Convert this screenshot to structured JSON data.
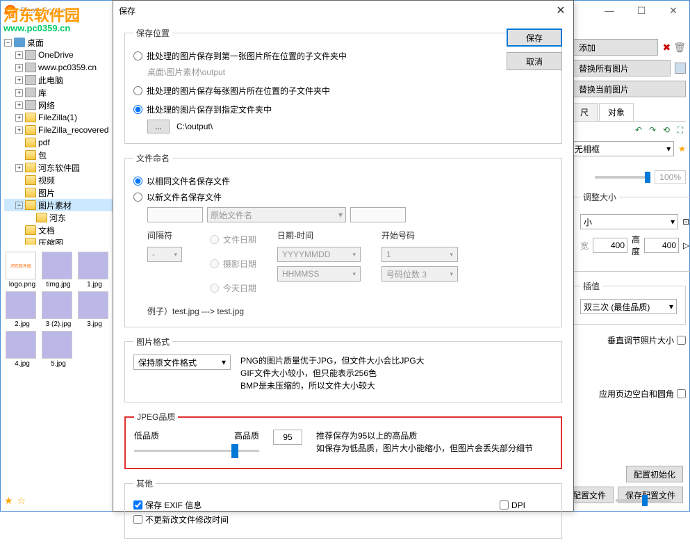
{
  "mainwin": {
    "app_name": "PhotoScape",
    "controls": {
      "min": "—",
      "max": "☐",
      "close": "✕"
    }
  },
  "logo": {
    "line1": "河东软件园",
    "line2": "www.pc0359.cn"
  },
  "tree": {
    "root": "桌面",
    "items": [
      {
        "indent": 0,
        "exp": "⊟",
        "icon": "desktop",
        "label": "桌面"
      },
      {
        "indent": 1,
        "exp": "⊞",
        "icon": "cloud",
        "label": "OneDrive"
      },
      {
        "indent": 1,
        "exp": "⊞",
        "icon": "drive",
        "label": "www.pc0359.cn"
      },
      {
        "indent": 1,
        "exp": "⊞",
        "icon": "drive",
        "label": "此电脑"
      },
      {
        "indent": 1,
        "exp": "⊞",
        "icon": "drive",
        "label": "库"
      },
      {
        "indent": 1,
        "exp": "⊞",
        "icon": "drive",
        "label": "网络"
      },
      {
        "indent": 1,
        "exp": "⊞",
        "icon": "folder",
        "label": "FileZilla(1)"
      },
      {
        "indent": 1,
        "exp": "⊞",
        "icon": "folder",
        "label": "FileZilla_recovered"
      },
      {
        "indent": 1,
        "exp": "",
        "icon": "folder",
        "label": "pdf"
      },
      {
        "indent": 1,
        "exp": "",
        "icon": "folder",
        "label": "包"
      },
      {
        "indent": 1,
        "exp": "⊞",
        "icon": "folder",
        "label": "河东软件园"
      },
      {
        "indent": 1,
        "exp": "",
        "icon": "folder",
        "label": "视频"
      },
      {
        "indent": 1,
        "exp": "",
        "icon": "folder",
        "label": "图片"
      },
      {
        "indent": 1,
        "exp": "⊟",
        "icon": "folder",
        "label": "图片素材",
        "selected": true
      },
      {
        "indent": 2,
        "exp": "",
        "icon": "folder",
        "label": "河东"
      },
      {
        "indent": 1,
        "exp": "",
        "icon": "folder",
        "label": "文档"
      },
      {
        "indent": 1,
        "exp": "",
        "icon": "folder",
        "label": "压缩图"
      }
    ]
  },
  "thumbs": [
    {
      "label": "logo.png",
      "kind": "logo"
    },
    {
      "label": "timg.jpg",
      "kind": "img"
    },
    {
      "label": "1.jpg",
      "kind": "img"
    },
    {
      "label": "2.jpg",
      "kind": "img"
    },
    {
      "label": "3 (2).jpg",
      "kind": "img"
    },
    {
      "label": "3.jpg",
      "kind": "img"
    },
    {
      "label": "4.jpg",
      "kind": "img"
    },
    {
      "label": "5.jpg",
      "kind": "img"
    }
  ],
  "dialog": {
    "title": "保存",
    "close": "✕",
    "btn_save": "保存",
    "btn_cancel": "取消",
    "location": {
      "legend": "保存位置",
      "opt1": "批处理的图片保存到第一张图片所在位置的子文件夹中",
      "opt1_path": "桌面\\图片素材\\output",
      "opt2": "批处理的图片保存每张图片所在位置的子文件夹中",
      "opt3": "批处理的图片保存到指定文件夹中",
      "browse": "...",
      "out_path": "C:\\output\\"
    },
    "naming": {
      "legend": "文件命名",
      "opt1": "以相同文件名保存文件",
      "opt2": "以新文件名保存文件",
      "prefix": "",
      "basename": "原始文件名",
      "suffix": "",
      "sep_label": "间隔符",
      "sep": "-",
      "filedate": "文件日期",
      "shotdate": "摄影日期",
      "today": "今天日期",
      "datetime_label": "日期-时间",
      "date_fmt": "YYYYMMDD",
      "time_fmt": "HHMMSS",
      "startno_label": "开始号码",
      "startno": "1",
      "digits_label": "号码位数 3",
      "example": "例子）test.jpg ---> test.jpg"
    },
    "format": {
      "legend": "图片格式",
      "keep": "保持原文件格式",
      "desc1": "PNG的图片质量优于JPG，但文件大小会比JPG大",
      "desc2": "GIF文件大小较小，但只能表示256色",
      "desc3": "BMP是未压缩的，所以文件大小较大"
    },
    "jpeg": {
      "legend": "JPEG品质",
      "low": "低品质",
      "high": "高品质",
      "value": "95",
      "desc1": "推荐保存为95以上的高品质",
      "desc2": "如保存为低品质，图片大小能缩小，但图片会丢失部分细节"
    },
    "other": {
      "legend": "其他",
      "exif": "保存 EXIF 信息",
      "nomtime": "不更新改文件修改时间",
      "dpi": "DPI"
    }
  },
  "right": {
    "add": "添加",
    "replace_all": "替换所有图片",
    "replace_current": "替换当前图片",
    "tab1": "尺",
    "tab2": "对象",
    "frame_none": "无相框",
    "percent": "100%",
    "resize_legend": "调整大小",
    "small": "小",
    "width_label": "宽",
    "width": "400",
    "height_label": "高度",
    "height": "400",
    "interp_legend": "插值",
    "interp": "双三次 (最佳品质)",
    "vertical_adjust": "垂直调节照片大小",
    "apply_margin": "应用页边空白和圆角",
    "reset_config": "配置初始化",
    "load_config": "配置文件",
    "save_config": "保存配置文件"
  }
}
